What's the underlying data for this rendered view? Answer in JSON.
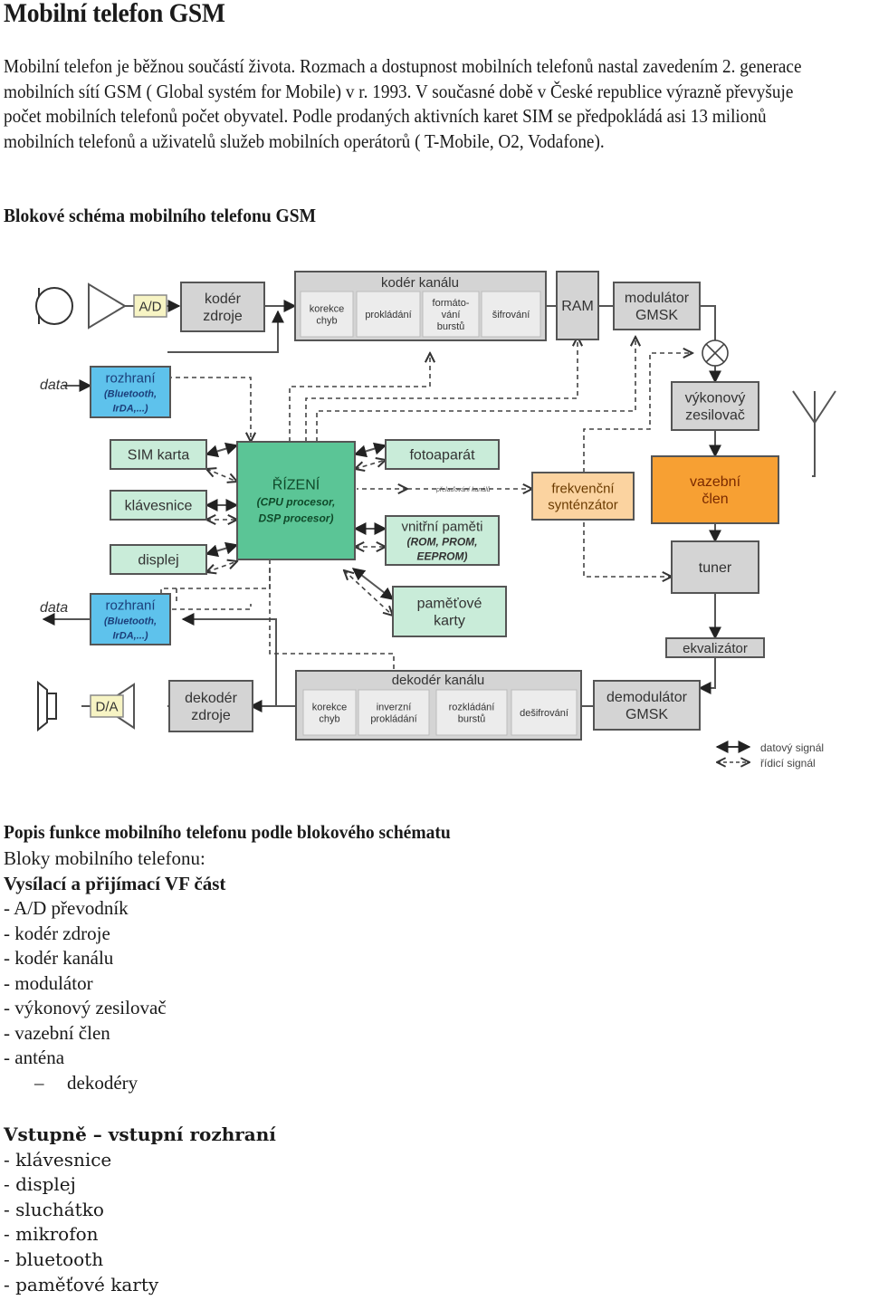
{
  "page": {
    "title": "Mobilní telefon GSM",
    "intro": "Mobilní telefon je běžnou součástí života. Rozmach a dostupnost mobilních telefonů nastal zavedením 2. generace mobilních sítí GSM ( Global systém for  Mobile) v r. 1993. V současné době v České republice výrazně převyšuje počet mobilních telefonů počet obyvatel. Podle prodaných aktivních karet SIM se předpokládá asi 13 milionů mobilních telefonů a uživatelů služeb mobilních operátorů ( T-Mobile, O2, Vodafone).",
    "diagram_heading": "Blokové schéma mobilního telefonu GSM"
  },
  "diagram": {
    "colors": {
      "gray_block": "#d4d4d4",
      "inner_block": "#ececec",
      "green_block": "#c9ecd9",
      "cpu_block": "#5bc596",
      "blue_block": "#5ec2ec",
      "orange_block": "#f7a033",
      "light_orange_block": "#fbd3a0",
      "yellow_block": "#f7f4c4",
      "border": "#555555"
    },
    "blocks": {
      "ad": "A/D",
      "da": "D/A",
      "source_coder": [
        "kodér",
        "zdroje"
      ],
      "source_decoder": [
        "dekodér",
        "zdroje"
      ],
      "channel_coder": {
        "title": "kodér kanálu",
        "items": [
          [
            "korekce",
            "chyb"
          ],
          [
            "prokládání"
          ],
          [
            "formáto-",
            "vání",
            "burstů"
          ],
          [
            "šifrování"
          ]
        ]
      },
      "channel_decoder": {
        "title": "dekodér kanálu",
        "items": [
          [
            "korekce",
            "chyb"
          ],
          [
            "inverzní",
            "prokládání"
          ],
          [
            "rozkládání",
            "burstů"
          ],
          [
            "dešifrování"
          ]
        ]
      },
      "ram": "RAM",
      "modulator": [
        "modulátor",
        "GMSK"
      ],
      "demodulator": [
        "demodulátor",
        "GMSK"
      ],
      "power_amp": [
        "výkonový",
        "zesilovač"
      ],
      "coupler": [
        "vazební",
        "člen"
      ],
      "tuner": "tuner",
      "equalizer": "ekvalizátor",
      "freq_synth": [
        "frekvenční",
        "synténzátor"
      ],
      "interface_in": [
        "rozhraní",
        "(Bluetooth,",
        "IrDA,...)"
      ],
      "interface_out": [
        "rozhraní",
        "(Bluetooth,",
        "IrDA,...)"
      ],
      "sim": "SIM karta",
      "keyboard": "klávesnice",
      "display": "displej",
      "camera": "fotoaparát",
      "cpu": [
        "ŘÍZENÍ",
        "(CPU procesor,",
        "DSP procesor)"
      ],
      "internal_mem": [
        "vnitřní paměti",
        "(ROM, PROM,",
        "EEPROM)"
      ],
      "mem_cards": [
        "paměťové",
        "karty"
      ]
    },
    "labels": {
      "data_in": "data",
      "data_out": "data",
      "channel_switch": "přelaďování kanálů"
    },
    "legend": {
      "data_signal": "datový signál",
      "control_signal": "řídicí signál"
    }
  },
  "description": {
    "heading": "Popis funkce mobilního telefonu podle blokového schématu",
    "subheading": "Bloky mobilního telefonu:",
    "rf_heading": "Vysílací a přijímací VF část",
    "rf_items": [
      "- A/D převodník",
      "- kodér zdroje",
      "- kodér kanálu",
      "- modulátor",
      "- výkonový zesilovač",
      "- vazební člen",
      "- anténa"
    ],
    "rf_subitem_marker": "–",
    "rf_subitem": "dekodéry",
    "io_heading": "Vstupně – vstupní rozhraní",
    "io_items": [
      "- klávesnice",
      "- displej",
      "- sluchátko",
      "- mikrofon",
      "- bluetooth",
      "- paměťové karty"
    ]
  }
}
